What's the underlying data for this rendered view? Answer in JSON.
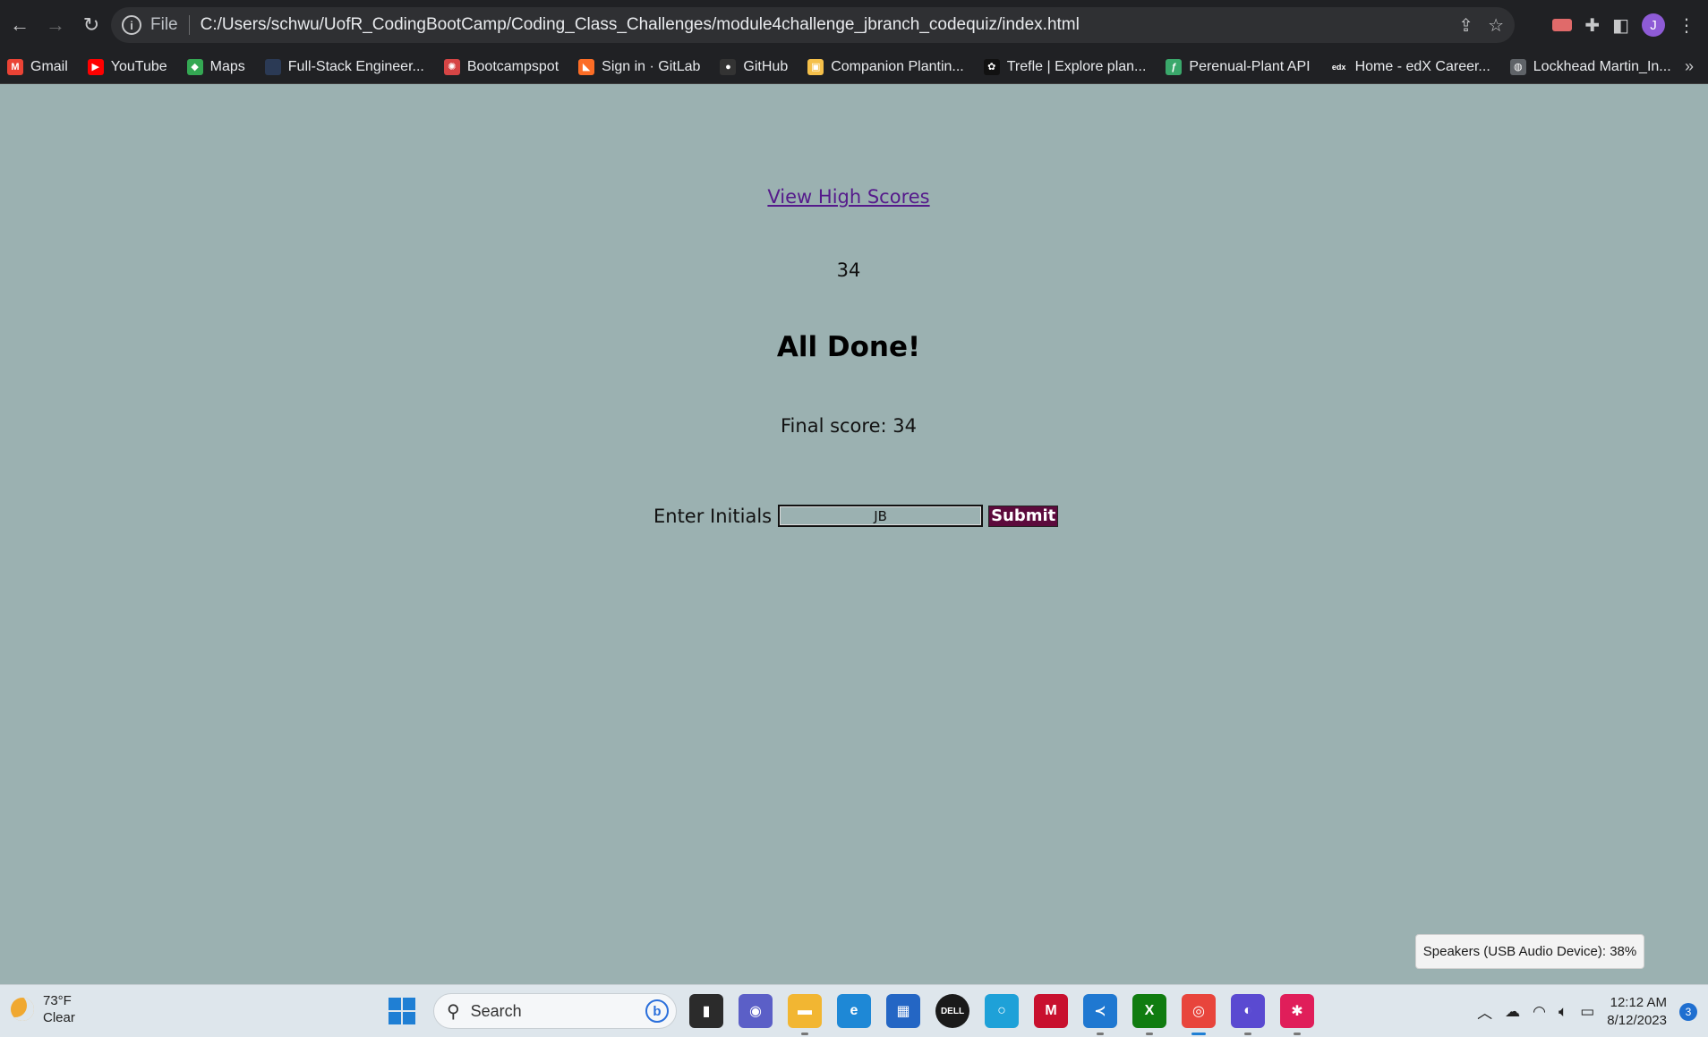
{
  "browser": {
    "scheme_label": "File",
    "url": "C:/Users/schwu/UofR_CodingBootCamp/Coding_Class_Challenges/module4challenge_jbranch_codequiz/index.html",
    "profile_initial": "J"
  },
  "bookmarks": [
    {
      "label": "Gmail",
      "icon": "gmail-icon",
      "color": "#ea4335",
      "glyph": "M"
    },
    {
      "label": "YouTube",
      "icon": "youtube-icon",
      "color": "#ff0000",
      "glyph": "▶"
    },
    {
      "label": "Maps",
      "icon": "maps-icon",
      "color": "#34a853",
      "glyph": "◆"
    },
    {
      "label": "Full-Stack Engineer...",
      "icon": "page-icon",
      "color": "#2b3a55",
      "glyph": ""
    },
    {
      "label": "Bootcampspot",
      "icon": "bootcampspot-icon",
      "color": "#d64545",
      "glyph": "✺"
    },
    {
      "label": "Sign in · GitLab",
      "icon": "gitlab-icon",
      "color": "#fc6d26",
      "glyph": "◣"
    },
    {
      "label": "GitHub",
      "icon": "github-icon",
      "color": "#333333",
      "glyph": "●"
    },
    {
      "label": "Companion Plantin...",
      "icon": "companion-planting-icon",
      "color": "#f5c04a",
      "glyph": "▣"
    },
    {
      "label": "Trefle | Explore plan...",
      "icon": "trefle-icon",
      "color": "#111111",
      "glyph": "✿"
    },
    {
      "label": "Perenual-Plant API",
      "icon": "perenual-icon",
      "color": "#3aa86b",
      "glyph": "ƒ"
    },
    {
      "label": "Home - edX Career...",
      "icon": "edx-icon",
      "color": "#202124",
      "glyph": "edx"
    },
    {
      "label": "Lockhead Martin_In...",
      "icon": "globe-icon",
      "color": "#5f6368",
      "glyph": "◍"
    }
  ],
  "quiz": {
    "high_scores_link": "View High Scores",
    "timer": "34",
    "title": "All Done!",
    "final_score": "Final score: 34",
    "initials_label": "Enter Initials",
    "initials_value": "JB",
    "submit_label": "Submit"
  },
  "toast": "Speakers (USB Audio Device): 38%",
  "taskbar": {
    "temperature": "73°F",
    "condition": "Clear",
    "search_placeholder": "Search",
    "time": "12:12 AM",
    "date": "8/12/2023",
    "notification_count": "3",
    "apps": [
      {
        "name": "task-view-icon",
        "color": "#2b2b2b",
        "glyph": "▮",
        "state": ""
      },
      {
        "name": "teams-chat-icon",
        "color": "#5b5fc7",
        "glyph": "◉",
        "state": ""
      },
      {
        "name": "file-explorer-icon",
        "color": "#f2b632",
        "glyph": "▬",
        "state": "running"
      },
      {
        "name": "edge-icon",
        "color": "#1e88d6",
        "glyph": "e",
        "state": ""
      },
      {
        "name": "microsoft-store-icon",
        "color": "#2466c4",
        "glyph": "▦",
        "state": ""
      },
      {
        "name": "dell-icon",
        "color": "#1a1a1a",
        "glyph": "DELL",
        "state": ""
      },
      {
        "name": "alexa-icon",
        "color": "#1ea1d8",
        "glyph": "○",
        "state": ""
      },
      {
        "name": "mcafee-icon",
        "color": "#c8102e",
        "glyph": "M",
        "state": ""
      },
      {
        "name": "vscode-icon",
        "color": "#1f78d1",
        "glyph": "≺",
        "state": "running"
      },
      {
        "name": "xbox-icon",
        "color": "#107c10",
        "glyph": "X",
        "state": "running"
      },
      {
        "name": "chrome-icon",
        "color": "#e8453c",
        "glyph": "◎",
        "state": "active"
      },
      {
        "name": "moon-app-icon",
        "color": "#5a4ad1",
        "glyph": "◐",
        "state": "running"
      },
      {
        "name": "slack-icon",
        "color": "#e01e5a",
        "glyph": "✱",
        "state": "running"
      }
    ]
  }
}
